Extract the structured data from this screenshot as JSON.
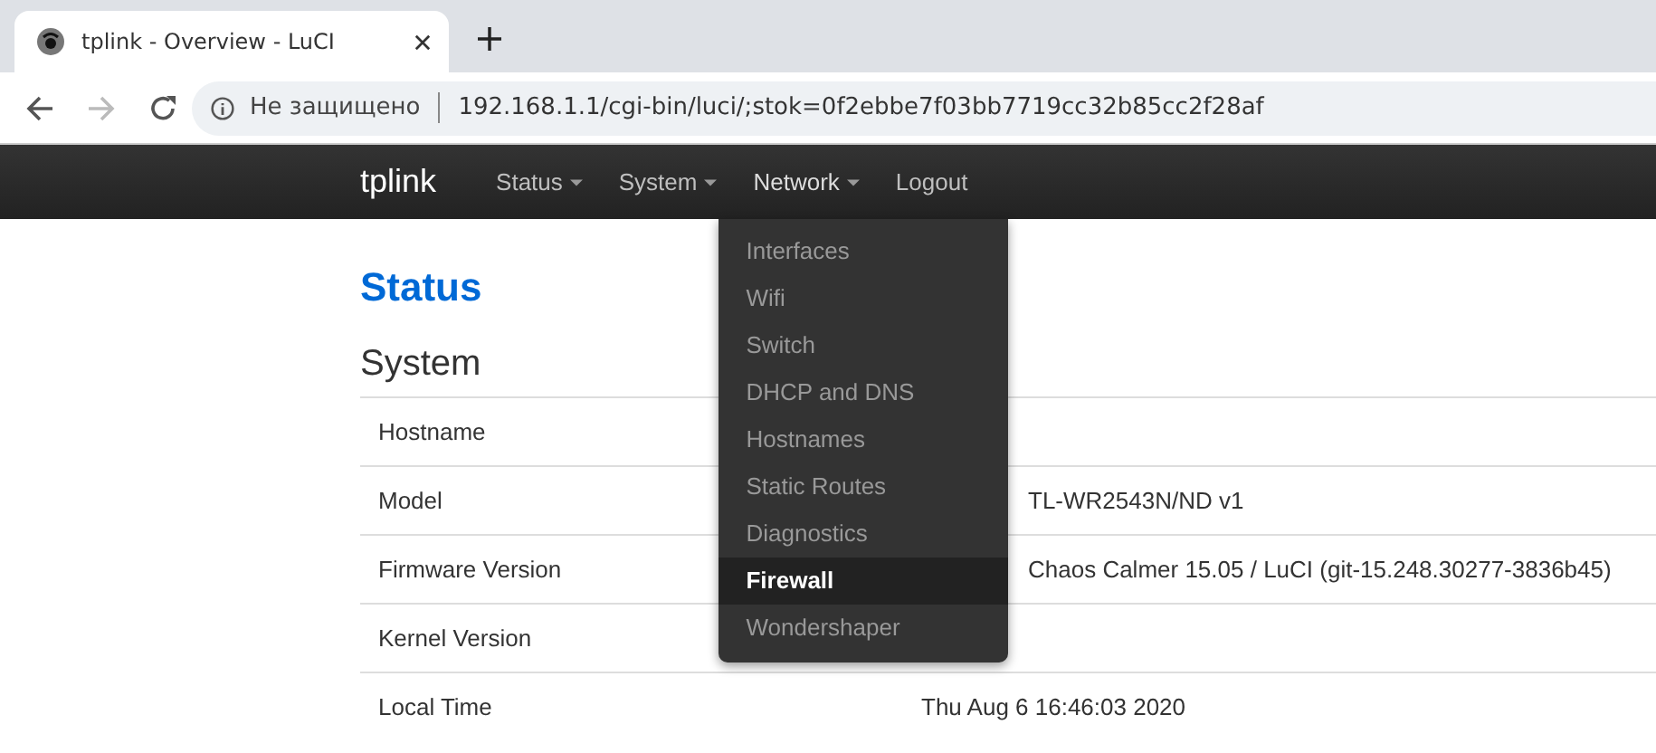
{
  "browser": {
    "tab_title": "tplink - Overview - LuCI",
    "security_label": "Не защищено",
    "url": "192.168.1.1/cgi-bin/luci/;stok=0f2ebbe7f03bb7719cc32b85cc2f28af",
    "forward_disabled": true
  },
  "navbar": {
    "brand": "tplink",
    "menus": [
      {
        "label": "Status",
        "dropdown": true,
        "open": false
      },
      {
        "label": "System",
        "dropdown": true,
        "open": false
      },
      {
        "label": "Network",
        "dropdown": true,
        "open": true
      },
      {
        "label": "Logout",
        "dropdown": false,
        "open": false
      }
    ]
  },
  "dropdown": {
    "items": [
      {
        "label": "Interfaces",
        "selected": false
      },
      {
        "label": "Wifi",
        "selected": false
      },
      {
        "label": "Switch",
        "selected": false
      },
      {
        "label": "DHCP and DNS",
        "selected": false
      },
      {
        "label": "Hostnames",
        "selected": false
      },
      {
        "label": "Static Routes",
        "selected": false
      },
      {
        "label": "Diagnostics",
        "selected": false
      },
      {
        "label": "Firewall",
        "selected": true
      },
      {
        "label": "Wondershaper",
        "selected": false
      }
    ]
  },
  "page_title": "Status",
  "section_title": "System",
  "rows": [
    {
      "label": "Hostname"
    },
    {
      "label": "Model",
      "value": "TL-WR2543N/ND v1",
      "kind": "cut"
    },
    {
      "label": "Firmware Version",
      "value": "Chaos Calmer 15.05 / LuCI (git-15.248.30277-3836b45)",
      "kind": "cut"
    },
    {
      "label": "Kernel Version"
    },
    {
      "label": "Local Time",
      "value": "Thu Aug 6 16:46:03 2020",
      "kind": "full"
    }
  ]
}
